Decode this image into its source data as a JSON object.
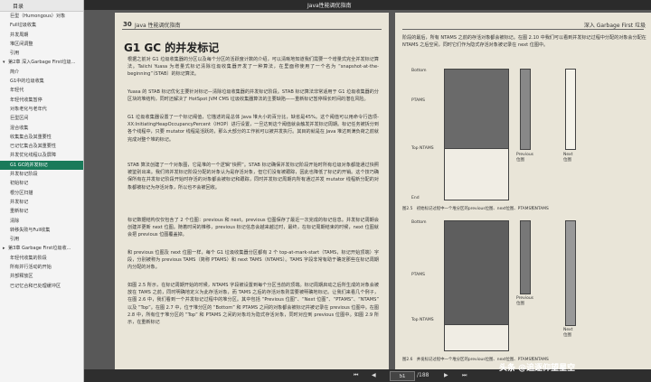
{
  "window": {
    "title": "Java性能调优指南"
  },
  "sidebar": {
    "tabs": [
      "目录"
    ],
    "items": [
      {
        "label": "巨型（Humongous）对象",
        "level": 1
      },
      {
        "label": "Full垃圾收集",
        "level": 1
      },
      {
        "label": "并发周期",
        "level": 1
      },
      {
        "label": "堆区间调整",
        "level": 1
      },
      {
        "label": "引用",
        "level": 1
      },
      {
        "label": "第2章 深入Garbage First垃圾...",
        "level": 0,
        "arrow": "▾"
      },
      {
        "label": "简介",
        "level": 1
      },
      {
        "label": "G1中的垃圾收集",
        "level": 1
      },
      {
        "label": "年轻代",
        "level": 1
      },
      {
        "label": "年轻代收集暂停",
        "level": 1
      },
      {
        "label": "对象老化与老年代",
        "level": 1
      },
      {
        "label": "巨型区间",
        "level": 1
      },
      {
        "label": "混合收集",
        "level": 1
      },
      {
        "label": "收集集合及其重要性",
        "level": 1
      },
      {
        "label": "已记忆集合及其重要性",
        "level": 1
      },
      {
        "label": "并发优化线程以及屏障",
        "level": 1
      },
      {
        "label": "G1 GC的并发标记",
        "level": 1,
        "active": true
      },
      {
        "label": "并发标记阶段",
        "level": 1
      },
      {
        "label": "初始标记",
        "level": 1
      },
      {
        "label": "根分区扫描",
        "level": 1
      },
      {
        "label": "并发标记",
        "level": 1
      },
      {
        "label": "重新标记",
        "level": 1
      },
      {
        "label": "清除",
        "level": 1
      },
      {
        "label": "转移失败与Full收集",
        "level": 1
      },
      {
        "label": "引用",
        "level": 1
      },
      {
        "label": "第3章 Garbage First垃圾收...",
        "level": 0,
        "arrow": "▸"
      },
      {
        "label": "年轻代收集的阶段",
        "level": 1
      },
      {
        "label": "所有并行活动的开始",
        "level": 1
      },
      {
        "label": "并部释放区",
        "level": 1
      },
      {
        "label": "已记忆合和已处理缓冲区",
        "level": 1
      }
    ]
  },
  "left_page": {
    "page_number": "30",
    "chapter": "Java 性能调优指南",
    "section_title": "G1 GC 的并发标记",
    "paragraphs": [
      "根据之前对 G1 垃圾收集器的分区以及每个分区的活跃度计数的介绍，可以清晰地知道我们需要一个增量式完全并发标记算法。Taiichi Yuasa 为增量式标记清除垃圾收集器开发了一种算法，在里面称使用了一个名为 “snapshot-at-the-beginning”（STAB）的标记算法。",
      "Yuasa 的 STAB 标记优化主要针对标记—清除垃圾收集器的并发标记阶段。STAB 标记算法非常适用于 G1 垃圾收集器的分区块的堆结构，同时还解决了 HotSpot JVM CMS 垃圾收集器算法的主要缺陷——重新标记暂停相长时间的潜在风险。",
      "G1 垃圾收集器设置了一个标记阈值，它描述的是总体 Java 堆大小的百分比，缺省是45%。这个阈值可以用命令行选项-XX:InitiatingHeapOccupancyPercent（IHOP）进行设置，一旦达到这个阈值就会触发并发标记周期。标记任务被拆分到各个线程中，只要 mutator 线程是活跃的，那么大部分的工作就可以被并发执行。其目的就是在 Java 堆达到满负荷之前就完成对整个堆的标记。",
      "STAB 算法创建了一个对象图，它是堆的一个逻辑“快照”。STAB 标记确保并发标记阶段开始时所有垃圾对象都能通过快照被鉴别出来。我们将并发标记阶段分配的对象认为是存活对象，但它们没有被跟踪，因此也降低了标记的开销。这个技巧确保所有在并发标记阶段开始时存活的对象都会被标记和跟踪，同时并发标记周期内所有通过并发 mutator 线程新分配的对象都被标记为存活对象，所以也不会被回收。",
      "标记数据结构仅仅包含了 2 个位图：previous 和 next。previous 位图保存了最近一次完成的标记信息。并发标记周期会创建并更新 next 位图。随着时间的推移，previous 标记信息会越来越过时，最终，在标记周期结束的时候，next 位图就会把 previous 位图覆盖掉。",
      "和 previous 位图及 next 位图一样，每个 G1 垃圾收集器分区都有 2 个 top-at-mark-start（TAMS，标记开始顶端）字段，分别被称为 previous TAMS（简称 PTAMS）和 next TAMS（NTAMS）。TAMS 字段非常有助于确定那些在标记周期内分配的对象。",
      "如图 2.5 所示，在标记周期开始的时候，NTAMS 字段被设置到每个分区当前的顶端。标记周期启动之后所生成的对象会被放在 TAMS 之前，同时明确地定义为此存活对象，而 TAMS 之后的存活对象则需要被明确地标记。让我们来看几个例子，在图 2.6 中，我们看到一个并发标记过程中的堆分区。其中包括 “Previous 位图”、“Next 位图”、“PTAMS”、“NTAMS” 以及 “Top”。在图 2.7 中，位于堆分区的 “Bottom” 和 PTAMS 之间的对象都会被标记并被记录在 previous 位图中。在图 2.8 中，所有位于堆分区的 “Top” 和 PTAMS 之间的对象均为隐式存活对象，同时对应到 previous 位图中。如图 2.9 所示，在重新标记"
    ]
  },
  "right_page": {
    "chapter": "深入 Garbage First 垃圾",
    "paragraphs": [
      "阶段的最后，所有 NTAMS 之前的存活对象都会被标记。在图 2.10 中我们可以看到并发标记过程中分配的对象会分配在 NTAMS 之后空间，同时它们作为隐式存活对象被记录在 next 位图中。"
    ],
    "figure1": {
      "labels": [
        "Bottom",
        "PTAMS",
        "Top\nNTAMS",
        "End"
      ],
      "side1": "Previous\n位图",
      "side2": "Next\n位图",
      "caption": "图2.5　初始标记过程中一个堆分区的previous位图、next位图、PTAMS和NTAMS"
    },
    "figure2": {
      "labels": [
        "Bottom",
        "PTAMS",
        "Top\nNTAMS"
      ],
      "side1": "Previous\n位图",
      "side2": "Next\n位图",
      "caption": "图2.6　并发标记过程中一个堆分区的previous位图、next位图、PTAMS和NTAMS"
    }
  },
  "statusbar": {
    "first": "⏮",
    "prev": "◀",
    "page": "51",
    "total": "/188",
    "next": "▶",
    "last": "⏭"
  },
  "watermark": "头条 @追逐仰望星空"
}
